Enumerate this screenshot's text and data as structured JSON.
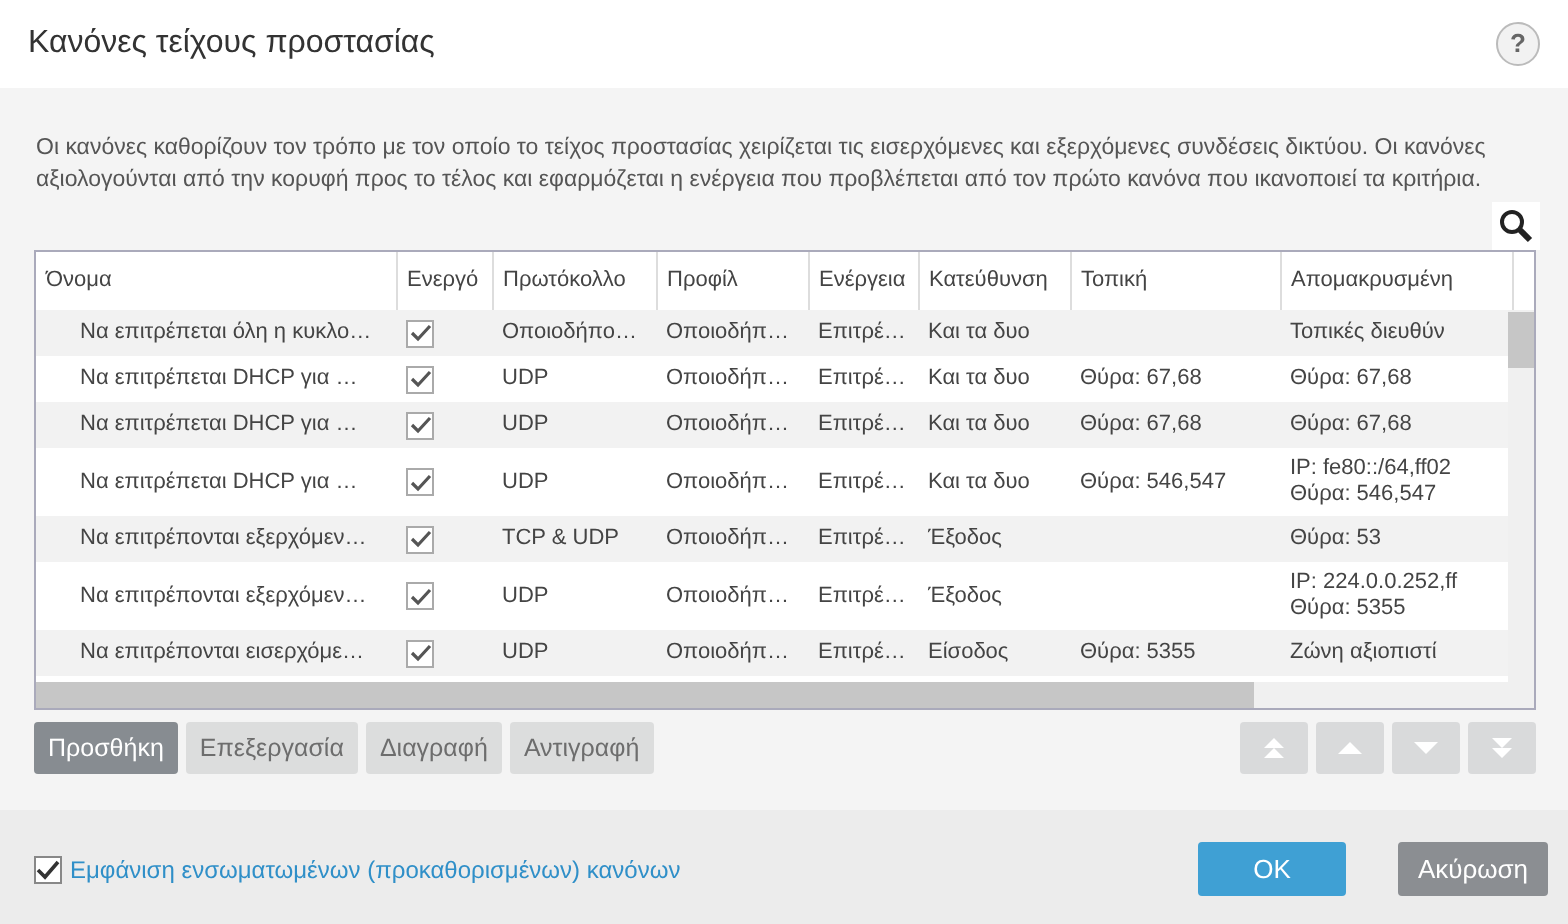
{
  "window": {
    "title": "Κανόνες τείχους προστασίας",
    "help": "?"
  },
  "description": "Οι κανόνες καθορίζουν τον τρόπο με τον οποίο το τείχος προστασίας χειρίζεται τις εισερχόμενες και εξερχόμενες συνδέσεις δικτύου. Οι κανόνες αξιολογούνται από την κορυφή προς το τέλος και εφαρμόζεται η ενέργεια που προβλέπεται από τον πρώτο κανόνα που ικανοποιεί τα κριτήρια.",
  "table": {
    "columns": [
      "Όνομα",
      "Ενεργό",
      "Πρωτόκολλο",
      "Προφίλ",
      "Ενέργεια",
      "Κατεύθυνση",
      "Τοπική",
      "Απομακρυσμένη"
    ],
    "rows": [
      {
        "name": "Να επιτρέπεται όλη η κυκλο…",
        "enabled": true,
        "protocol": "Οποιοδήπο…",
        "profile": "Οποιοδήπ…",
        "action": "Επιτρέ…",
        "direction": "Και τα δυο",
        "local": "",
        "remote": [
          "Τοπικές διευθύν"
        ]
      },
      {
        "name": "Να επιτρέπεται DHCP για …",
        "enabled": true,
        "protocol": "UDP",
        "profile": "Οποιοδήπ…",
        "action": "Επιτρέ…",
        "direction": "Και τα δυο",
        "local": "Θύρα: 67,68",
        "remote": [
          "Θύρα: 67,68"
        ]
      },
      {
        "name": "Να επιτρέπεται DHCP για …",
        "enabled": true,
        "protocol": "UDP",
        "profile": "Οποιοδήπ…",
        "action": "Επιτρέ…",
        "direction": "Και τα δυο",
        "local": "Θύρα: 67,68",
        "remote": [
          "Θύρα: 67,68"
        ]
      },
      {
        "name": "Να επιτρέπεται DHCP για …",
        "enabled": true,
        "protocol": "UDP",
        "profile": "Οποιοδήπ…",
        "action": "Επιτρέ…",
        "direction": "Και τα δυο",
        "local": "Θύρα: 546,547",
        "remote": [
          "IP: fe80::/64,ff02",
          "Θύρα: 546,547"
        ]
      },
      {
        "name": "Να επιτρέπονται εξερχόμεν…",
        "enabled": true,
        "protocol": "TCP & UDP",
        "profile": "Οποιοδήπ…",
        "action": "Επιτρέ…",
        "direction": "Έξοδος",
        "local": "",
        "remote": [
          "Θύρα: 53"
        ]
      },
      {
        "name": "Να επιτρέπονται εξερχόμεν…",
        "enabled": true,
        "protocol": "UDP",
        "profile": "Οποιοδήπ…",
        "action": "Επιτρέ…",
        "direction": "Έξοδος",
        "local": "",
        "remote": [
          "IP: 224.0.0.252,ff",
          "Θύρα: 5355"
        ]
      },
      {
        "name": "Να επιτρέπονται εισερχόμε…",
        "enabled": true,
        "protocol": "UDP",
        "profile": "Οποιοδήπ…",
        "action": "Επιτρέ…",
        "direction": "Είσοδος",
        "local": "Θύρα: 5355",
        "remote": [
          "Ζώνη αξιοπιστί"
        ]
      }
    ]
  },
  "actions": [
    {
      "label": "Προσθήκη",
      "disabled": false
    },
    {
      "label": "Επεξεργασία",
      "disabled": true
    },
    {
      "label": "Διαγραφή",
      "disabled": true
    },
    {
      "label": "Αντιγραφή",
      "disabled": true
    }
  ],
  "move_buttons": [
    {
      "kind": "top",
      "disabled": true
    },
    {
      "kind": "up",
      "disabled": true
    },
    {
      "kind": "down",
      "disabled": true
    },
    {
      "kind": "bottom",
      "disabled": true
    }
  ],
  "show_builtin": {
    "label": "Εμφάνιση ενσωματωμένων (προκαθορισμένων) κανόνων",
    "checked": true
  },
  "buttons": [
    {
      "label": "OK",
      "kind": "primary"
    },
    {
      "label": "Ακύρωση",
      "kind": "secondary"
    }
  ]
}
